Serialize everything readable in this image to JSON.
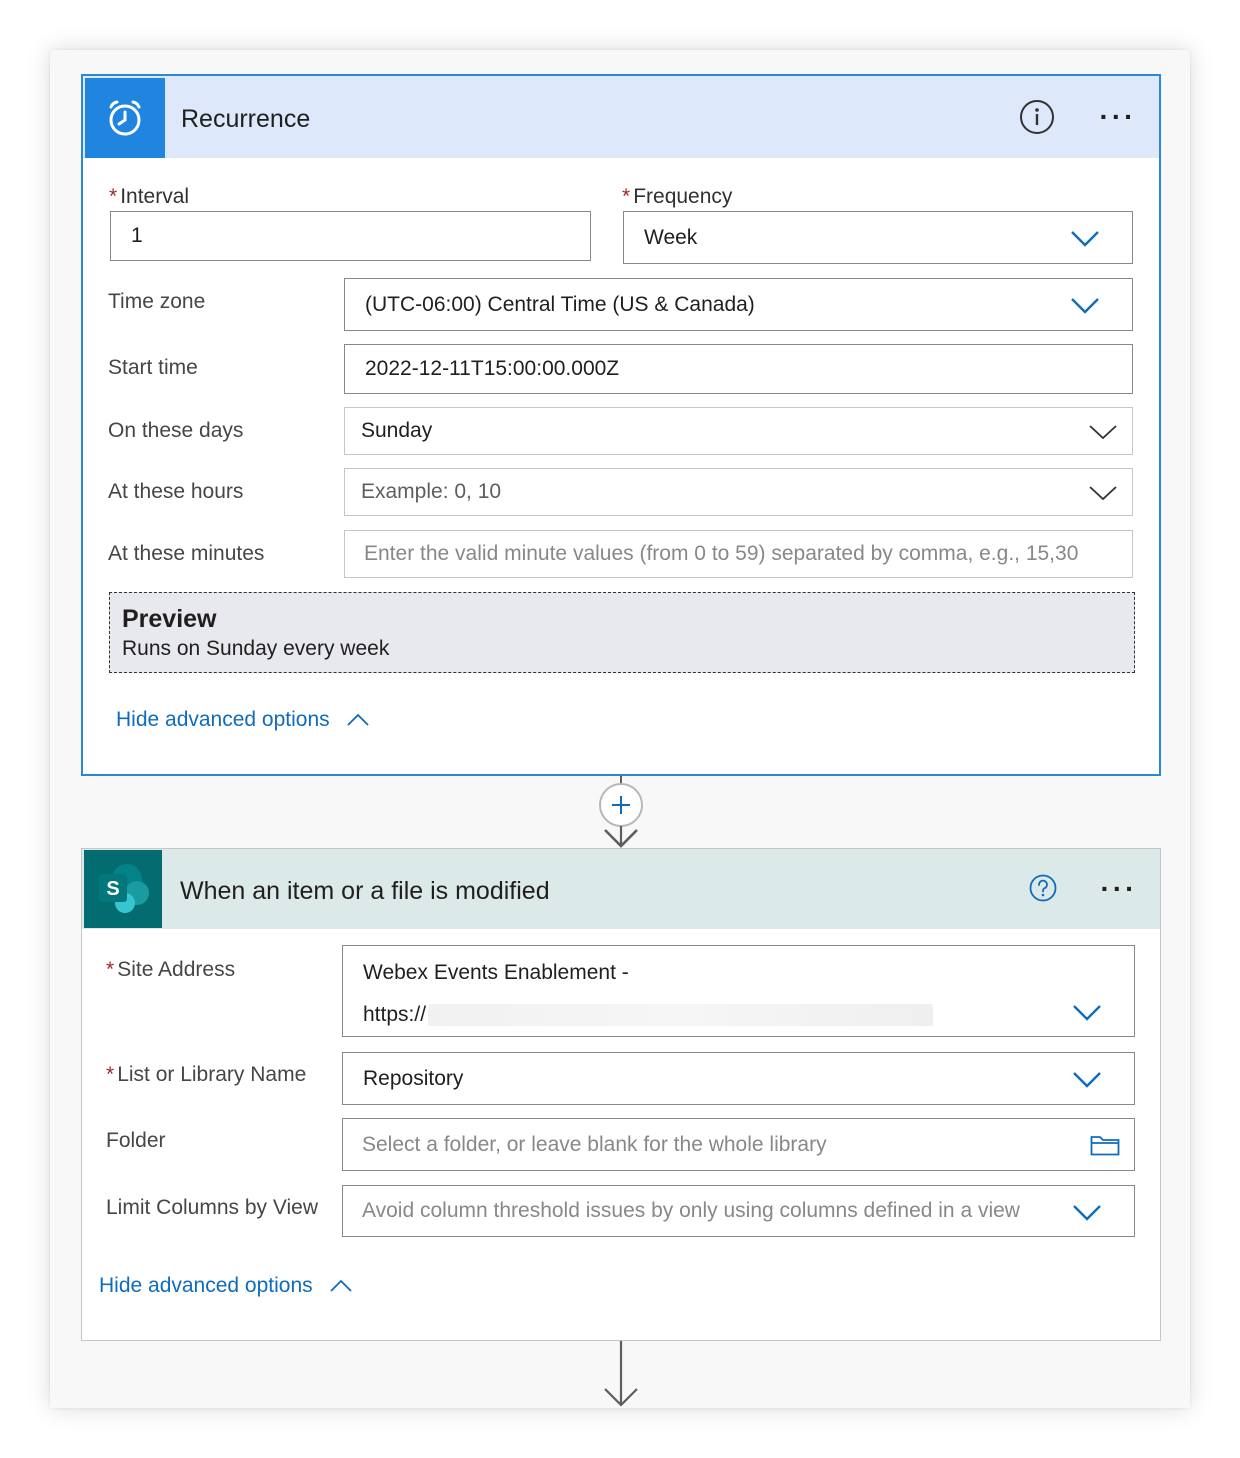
{
  "recurrence": {
    "title": "Recurrence",
    "icon": "alarm-clock-icon",
    "more_label": "···",
    "interval": {
      "label": "Interval",
      "value": "1"
    },
    "frequency": {
      "label": "Frequency",
      "value": "Week"
    },
    "time_zone": {
      "label": "Time zone",
      "value": "(UTC-06:00) Central Time (US & Canada)"
    },
    "start_time": {
      "label": "Start time",
      "value": "2022-12-11T15:00:00.000Z"
    },
    "on_these_days": {
      "label": "On these days",
      "value": "Sunday"
    },
    "at_these_hours": {
      "label": "At these hours",
      "placeholder": "Example: 0, 10"
    },
    "at_these_minutes": {
      "label": "At these minutes",
      "placeholder": "Enter the valid minute values (from 0 to 59) separated by comma, e.g., 15,30"
    },
    "preview": {
      "title": "Preview",
      "text": "Runs on Sunday every week"
    },
    "hide_advanced": "Hide advanced options",
    "required_mark": "*"
  },
  "trigger": {
    "title": "When an item or a file is modified",
    "icon": "sharepoint-icon",
    "icon_letter": "S",
    "more_label": "···",
    "site_address": {
      "label": "Site Address",
      "line1": "Webex Events Enablement -",
      "line2": "https://"
    },
    "list_name": {
      "label": "List or Library Name",
      "value": "Repository"
    },
    "folder": {
      "label": "Folder",
      "placeholder": "Select a folder, or leave blank for the whole library"
    },
    "limit_columns": {
      "label": "Limit Columns by View",
      "placeholder": "Avoid column threshold issues by only using columns defined in a view"
    },
    "hide_advanced": "Hide advanced options",
    "required_mark": "*"
  },
  "colors": {
    "accent": "#1f85de",
    "sharepoint": "#036c70",
    "link": "#0f6cbd",
    "required": "#a4262c"
  }
}
